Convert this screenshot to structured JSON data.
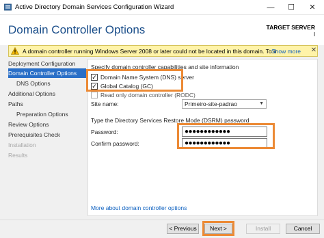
{
  "window": {
    "title": "Active Directory Domain Services Configuration Wizard",
    "minimize": "—",
    "maximize": "☐",
    "close": "✕"
  },
  "header": {
    "page_title": "Domain Controller Options",
    "target_label": "TARGET SERVER",
    "target_name": "l"
  },
  "warning": {
    "text": "A domain controller running Windows Server 2008 or later could not be located in this domain. To install a r...",
    "show_more": "Show more",
    "close": "✕",
    "icon": "warning-triangle-icon"
  },
  "nav": {
    "items": [
      {
        "label": "Deployment Configuration",
        "state": "normal"
      },
      {
        "label": "Domain Controller Options",
        "state": "active"
      },
      {
        "label": "DNS Options",
        "state": "normal"
      },
      {
        "label": "Additional Options",
        "state": "normal"
      },
      {
        "label": "Paths",
        "state": "normal"
      },
      {
        "label": "Preparation Options",
        "state": "normal"
      },
      {
        "label": "Review Options",
        "state": "normal"
      },
      {
        "label": "Prerequisites Check",
        "state": "normal"
      },
      {
        "label": "Installation",
        "state": "disabled"
      },
      {
        "label": "Results",
        "state": "disabled"
      }
    ]
  },
  "content": {
    "capabilities_heading": "Specify domain controller capabilities and site information",
    "dns_server": {
      "label": "Domain Name System (DNS) server",
      "checked": true,
      "mark": "✓"
    },
    "global_catalog": {
      "label": "Global Catalog (GC)",
      "checked": true,
      "mark": "✓"
    },
    "rodc": {
      "label": "Read only domain controller (RODC)",
      "checked": false,
      "mark": ""
    },
    "site_name_label": "Site name:",
    "site_name_value": "Primeiro-site-padrao",
    "dsrm_heading": "Type the Directory Services Restore Mode (DSRM) password",
    "password_label": "Password:",
    "password_value": "●●●●●●●●●●●●",
    "confirm_label": "Confirm password:",
    "confirm_value": "●●●●●●●●●●●●",
    "more_link": "More about domain controller options"
  },
  "buttons": {
    "previous": "< Previous",
    "next": "Next >",
    "install": "Install",
    "cancel": "Cancel"
  },
  "colors": {
    "accent": "#2a6fc7",
    "highlight": "#ec8a35",
    "warning_bg": "#fff3a8",
    "title_blue": "#1a4e8a",
    "link": "#0b5fbf"
  }
}
